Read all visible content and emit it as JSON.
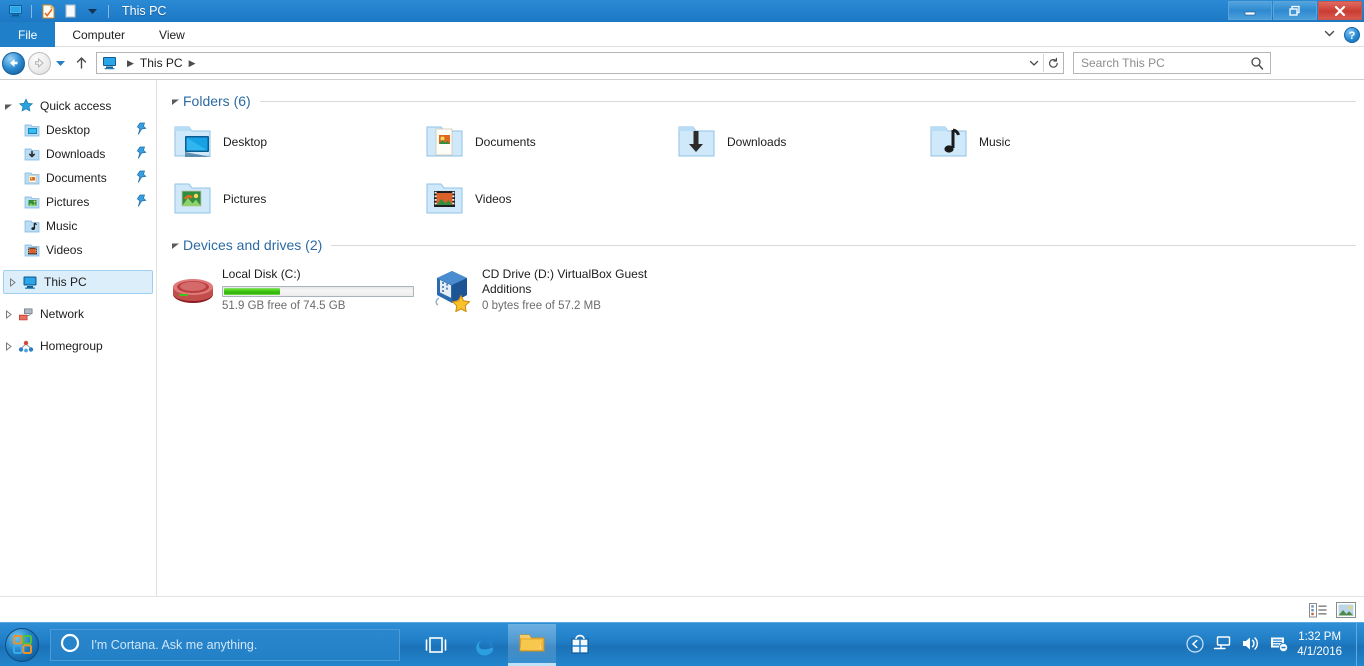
{
  "window": {
    "title": "This PC",
    "quick_access_toolbar": [
      {
        "name": "this-pc-icon",
        "label": "This PC"
      },
      {
        "name": "properties-icon",
        "label": "Properties"
      },
      {
        "name": "new-folder-icon",
        "label": "New folder"
      },
      {
        "name": "customize-dropdown-icon",
        "label": "Customize Quick Access Toolbar"
      }
    ],
    "controls": {
      "minimize": "Minimize",
      "restore": "Restore Down",
      "close": "Close"
    }
  },
  "ribbon": {
    "tabs": [
      {
        "label": "File",
        "active": true
      },
      {
        "label": "Computer",
        "active": false
      },
      {
        "label": "View",
        "active": false
      }
    ],
    "expand_label": "Expand the Ribbon",
    "help_label": "?"
  },
  "address": {
    "back_label": "Back to Desktop",
    "forward_label": "Forward",
    "recent_label": "Recent locations",
    "up_label": "Up to Desktop",
    "breadcrumb": [
      "This PC"
    ],
    "dropdown_label": "Previous Locations",
    "refresh_label": "Refresh This PC"
  },
  "search": {
    "placeholder": "Search This PC"
  },
  "sidebar": {
    "items": [
      {
        "label": "Quick access",
        "icon": "star-icon",
        "level": 0,
        "expanded": true,
        "pinned": false,
        "selected": false
      },
      {
        "label": "Desktop",
        "icon": "desktop-folder-icon",
        "level": 1,
        "pinned": true,
        "selected": false
      },
      {
        "label": "Downloads",
        "icon": "downloads-folder-icon",
        "level": 1,
        "pinned": true,
        "selected": false
      },
      {
        "label": "Documents",
        "icon": "documents-folder-icon",
        "level": 1,
        "pinned": true,
        "selected": false
      },
      {
        "label": "Pictures",
        "icon": "pictures-folder-icon",
        "level": 1,
        "pinned": true,
        "selected": false
      },
      {
        "label": "Music",
        "icon": "music-folder-icon",
        "level": 1,
        "pinned": false,
        "selected": false
      },
      {
        "label": "Videos",
        "icon": "videos-folder-icon",
        "level": 1,
        "pinned": false,
        "selected": false
      },
      {
        "label": "This PC",
        "icon": "this-pc-icon",
        "level": 0,
        "expanded": false,
        "pinned": false,
        "selected": true
      },
      {
        "label": "Network",
        "icon": "network-icon",
        "level": 0,
        "expanded": false,
        "pinned": false,
        "selected": false
      },
      {
        "label": "Homegroup",
        "icon": "homegroup-icon",
        "level": 0,
        "expanded": false,
        "pinned": false,
        "selected": false
      }
    ]
  },
  "content": {
    "folders_group": {
      "title": "Folders (6)",
      "items": [
        {
          "label": "Desktop",
          "icon": "desktop-folder-icon"
        },
        {
          "label": "Documents",
          "icon": "documents-folder-icon"
        },
        {
          "label": "Downloads",
          "icon": "downloads-folder-icon"
        },
        {
          "label": "Music",
          "icon": "music-folder-icon"
        },
        {
          "label": "Pictures",
          "icon": "pictures-folder-icon"
        },
        {
          "label": "Videos",
          "icon": "videos-folder-icon"
        }
      ]
    },
    "drives_group": {
      "title": "Devices and drives (2)",
      "items": [
        {
          "name": "Local Disk (C:)",
          "icon": "hard-disk-icon",
          "has_bar": true,
          "used_percent": 30,
          "free_text": "51.9 GB free of 74.5 GB",
          "bar_color": "#3fc40d"
        },
        {
          "name": "CD Drive (D:) VirtualBox Guest Additions",
          "icon": "virtualbox-cd-icon",
          "has_bar": false,
          "used_percent": 100,
          "free_text": "0 bytes free of 57.2 MB",
          "bar_color": "#3fc40d"
        }
      ]
    }
  },
  "statusbar": {
    "text": "",
    "views": [
      {
        "name": "details-view-button",
        "label": "Details view"
      },
      {
        "name": "large-icons-view-button",
        "label": "Large icons view"
      }
    ]
  },
  "taskbar": {
    "start_label": "Start",
    "cortana_placeholder": "I'm Cortana. Ask me anything.",
    "buttons": [
      {
        "name": "task-view-button",
        "label": "Task View",
        "active": false
      },
      {
        "name": "edge-button",
        "label": "Microsoft Edge",
        "active": false
      },
      {
        "name": "file-explorer-button",
        "label": "File Explorer",
        "active": true
      },
      {
        "name": "store-button",
        "label": "Store",
        "active": false
      }
    ],
    "tray": [
      {
        "name": "show-hidden-icons-button",
        "label": "Show hidden icons"
      },
      {
        "name": "network-icon",
        "label": "Network"
      },
      {
        "name": "volume-icon",
        "label": "Speakers"
      },
      {
        "name": "action-center-icon",
        "label": "Action Center"
      }
    ],
    "time": "1:32 PM",
    "date": "4/1/2016"
  },
  "colors": {
    "titlebar_blue": "#2280cd",
    "accent_blue": "#1f7fc9",
    "group_header": "#2c6ba3",
    "selection": "#ddeefb",
    "drive_green": "#3fc40d"
  }
}
